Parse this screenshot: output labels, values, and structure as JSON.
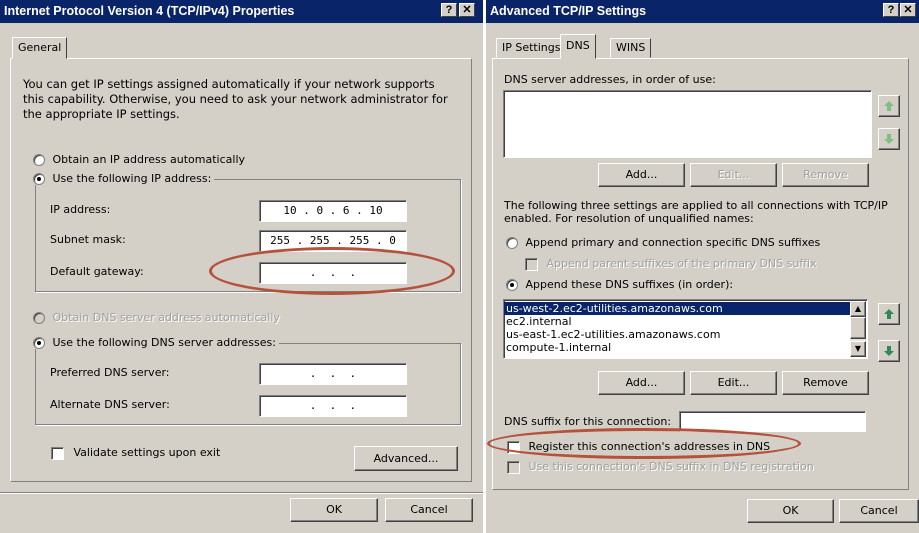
{
  "left_dialog": {
    "title": "Internet Protocol Version 4 (TCP/IPv4) Properties",
    "help_btn": "?",
    "close_btn": "✕",
    "tab_general": "General",
    "intro_text": "You can get IP settings assigned automatically if your network supports this capability. Otherwise, you need to ask your network administrator for the appropriate IP settings.",
    "radio_auto_ip": "Obtain an IP address automatically",
    "radio_manual_ip": "Use the following IP address:",
    "ip_label": "IP address:",
    "ip_value": "10 . 0 . 6 . 10",
    "subnet_label": "Subnet mask:",
    "subnet_value": "255 . 255 . 255 . 0",
    "gateway_label": "Default gateway:",
    "gateway_value": " .  .  . ",
    "radio_auto_dns": "Obtain DNS server address automatically",
    "radio_manual_dns": "Use the following DNS server addresses:",
    "preferred_label": "Preferred DNS server:",
    "preferred_value": " .  .  . ",
    "alternate_label": "Alternate DNS server:",
    "alternate_value": " .  .  . ",
    "validate_label": "Validate settings upon exit",
    "advanced_btn": "Advanced...",
    "ok_btn": "OK",
    "cancel_btn": "Cancel"
  },
  "right_dialog": {
    "title": "Advanced TCP/IP Settings",
    "help_btn": "?",
    "close_btn": "✕",
    "tabs": [
      "IP Settings",
      "DNS",
      "WINS"
    ],
    "dns_servers_label": "DNS server addresses, in order of use:",
    "add_btn": "Add...",
    "edit_btn": "Edit...",
    "remove_btn": "Remove",
    "settings_info": "The following three settings are applied to all connections with TCP/IP enabled. For resolution of unqualified names:",
    "radio_primary": "Append primary and connection specific DNS suffixes",
    "check_parent": "Append parent suffixes of the primary DNS suffix",
    "radio_these": "Append these DNS suffixes (in order):",
    "suffixes": [
      "us-west-2.ec2-utilities.amazonaws.com",
      "ec2.internal",
      "us-east-1.ec2-utilities.amazonaws.com",
      "compute-1.internal"
    ],
    "add2_btn": "Add...",
    "edit2_btn": "Edit...",
    "remove2_btn": "Remove",
    "suffix_conn_label": "DNS suffix for this connection:",
    "register_label": "Register this connection's addresses in DNS",
    "use_suffix_label": "Use this connection's DNS suffix in DNS registration",
    "ok_btn": "OK",
    "cancel_btn": "Cancel"
  },
  "colors": {
    "titlebar": "#0a246a",
    "annotation": "#b5523b",
    "arrow_green": "#2e8b57"
  }
}
